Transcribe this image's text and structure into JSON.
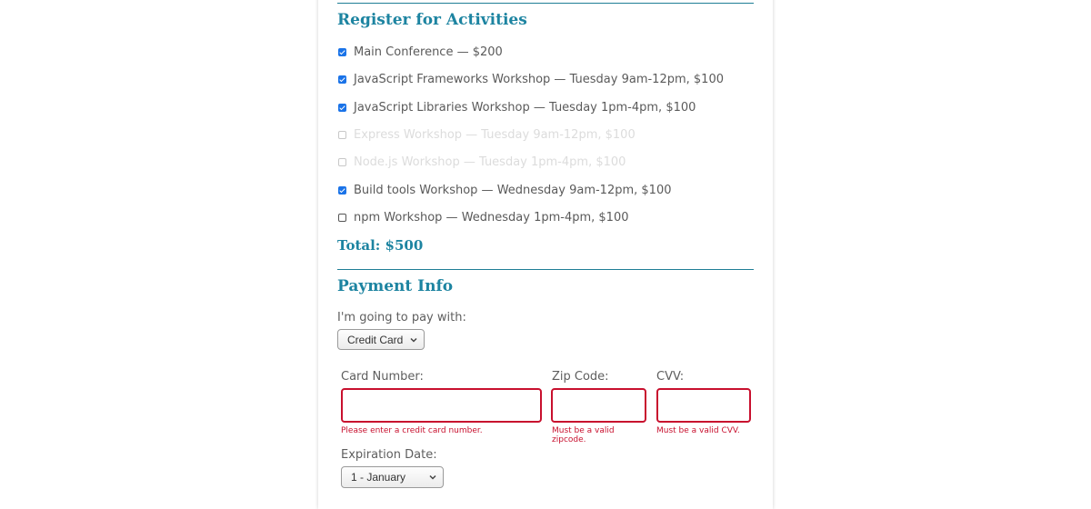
{
  "activities_section": {
    "heading": "Register for Activities",
    "items": [
      {
        "label": "Main Conference — $200",
        "checked": true,
        "disabled": false
      },
      {
        "label": "JavaScript Frameworks Workshop — Tuesday 9am-12pm, $100",
        "checked": true,
        "disabled": false
      },
      {
        "label": "JavaScript Libraries Workshop — Tuesday 1pm-4pm, $100",
        "checked": true,
        "disabled": false
      },
      {
        "label": "Express Workshop — Tuesday 9am-12pm, $100",
        "checked": false,
        "disabled": true
      },
      {
        "label": "Node.js Workshop — Tuesday 1pm-4pm, $100",
        "checked": false,
        "disabled": true
      },
      {
        "label": "Build tools Workshop — Wednesday 9am-12pm, $100",
        "checked": true,
        "disabled": false
      },
      {
        "label": "npm Workshop — Wednesday 1pm-4pm, $100",
        "checked": false,
        "disabled": false
      }
    ],
    "total": "Total: $500"
  },
  "payment_section": {
    "heading": "Payment Info",
    "method_label": "I'm going to pay with:",
    "method_selected": "Credit Card",
    "card_number_label": "Card Number:",
    "card_number_value": "",
    "card_number_error": "Please enter a credit card number.",
    "zip_label": "Zip Code:",
    "zip_value": "",
    "zip_error": "Must be a valid zipcode.",
    "cvv_label": "CVV:",
    "cvv_value": "",
    "cvv_error": "Must be a valid CVV.",
    "expiration_label": "Expiration Date:",
    "expiration_selected": "1 - January"
  },
  "colors": {
    "heading": "#1d84a1",
    "rule": "#1f7e96",
    "error": "#c8102e",
    "checkbox_checked": "#1a73e8"
  }
}
